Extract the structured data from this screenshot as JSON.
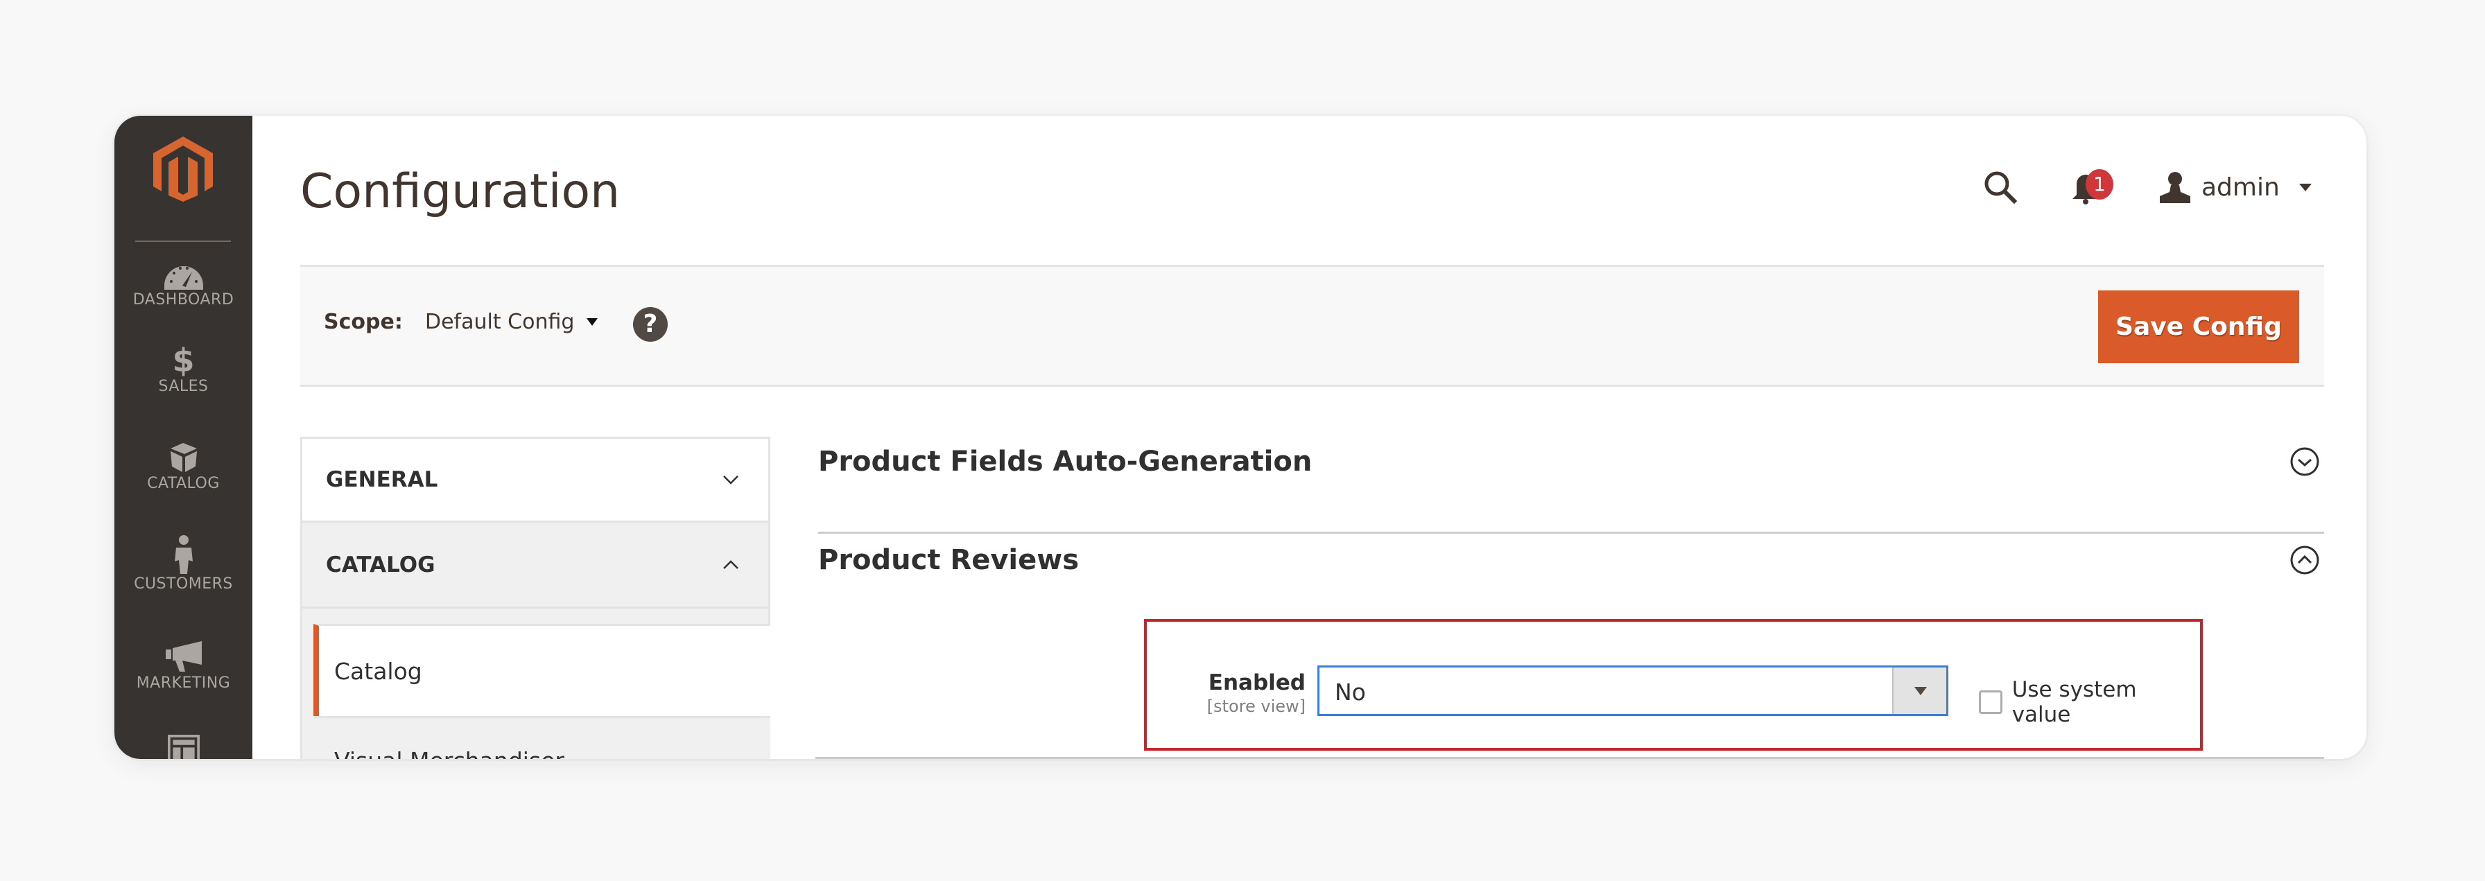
{
  "sidebar": {
    "logo": "magento-logo",
    "items": [
      {
        "label": "DASHBOARD",
        "icon": "dashboard-gauge-icon"
      },
      {
        "label": "SALES",
        "icon": "dollar-icon"
      },
      {
        "label": "CATALOG",
        "icon": "box-icon"
      },
      {
        "label": "CUSTOMERS",
        "icon": "person-icon"
      },
      {
        "label": "MARKETING",
        "icon": "megaphone-icon"
      },
      {
        "label": "",
        "icon": "content-layout-icon"
      }
    ]
  },
  "header": {
    "title": "Configuration",
    "notifications_count": "1",
    "user_name": "admin"
  },
  "scope": {
    "label": "Scope:",
    "value": "Default Config",
    "help": "?",
    "save_label": "Save Config"
  },
  "config_nav": {
    "sections": [
      {
        "label": "GENERAL",
        "expanded": false
      },
      {
        "label": "CATALOG",
        "expanded": true
      }
    ],
    "active_item": "Catalog",
    "next_item": "Visual Merchandiser"
  },
  "main": {
    "sections": [
      {
        "title": "Product Fields Auto-Generation",
        "expanded": false
      },
      {
        "title": "Product Reviews",
        "expanded": true
      }
    ],
    "field": {
      "label": "Enabled",
      "scope_hint": "[store view]",
      "value": "No",
      "use_system_value_label": "Use system value",
      "use_system_value_checked": false
    }
  },
  "colors": {
    "accent": "#da5b29",
    "sidebar_bg": "#373330",
    "highlight_border": "#c1272d",
    "focus_border": "#3b7fd4",
    "badge": "#d0373a"
  }
}
